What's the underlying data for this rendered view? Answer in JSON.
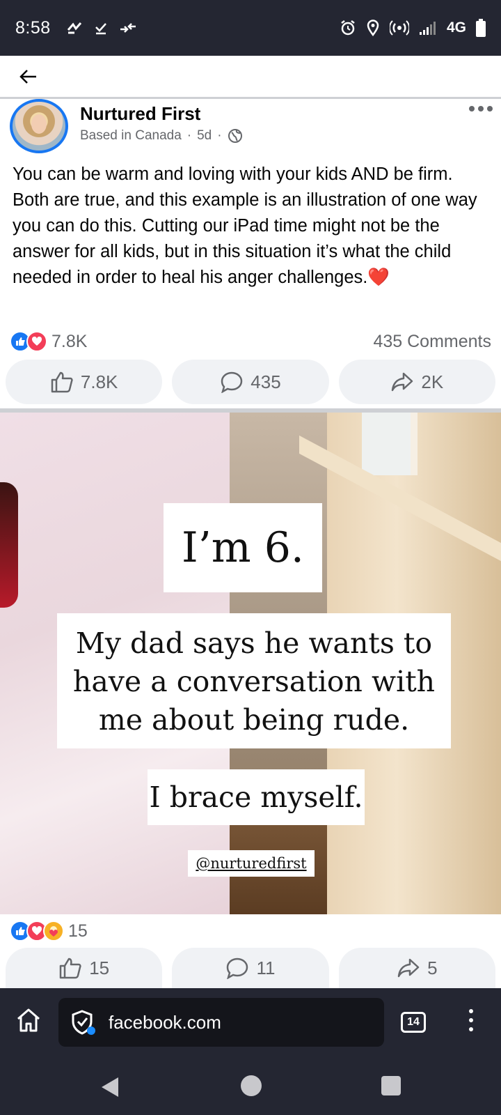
{
  "status_bar": {
    "time": "8:58",
    "network": "4G"
  },
  "nav": {
    "back_icon": "arrow-left-icon"
  },
  "post": {
    "page_name": "Nurtured First",
    "location": "Based in Canada",
    "age": "5d",
    "separator": "·",
    "text": "You can be warm and loving with your kids AND be firm.  Both are true, and this example is an illustration of one way you can do this. Cutting our iPad time might not be the answer for all kids, but in this situation it’s what the child needed in order to heal his anger challenges.",
    "text_emoji": "❤️",
    "reaction_count": "7.8K",
    "comments_label": "435 Comments",
    "actions": {
      "like": "7.8K",
      "comment": "435",
      "share": "2K"
    }
  },
  "photo_post": {
    "overlay_age": "I’m 6.",
    "overlay_dad": "My dad says he wants to have a conversation with me about being rude.",
    "overlay_brace": "I brace myself.",
    "overlay_handle": "@nurturedfirst",
    "reaction_count": "15",
    "actions": {
      "like": "15",
      "comment": "11",
      "share": "5"
    }
  },
  "browser": {
    "url": "facebook.com",
    "tab_count": "14"
  },
  "colors": {
    "facebook_blue": "#1877f2",
    "love_red": "#f33e58",
    "care_yellow": "#f7b125",
    "status_bar_bg": "#242632",
    "meta_gray": "#65676b"
  }
}
